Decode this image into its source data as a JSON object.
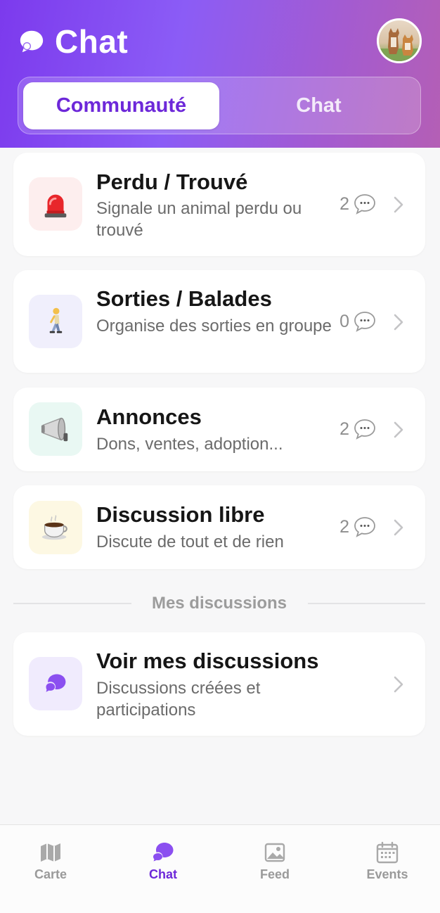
{
  "header": {
    "title": "Chat",
    "segments": [
      {
        "label": "Communauté",
        "active": true
      },
      {
        "label": "Chat",
        "active": false
      }
    ]
  },
  "categories": [
    {
      "title": "Perdu / Trouvé",
      "subtitle": "Signale un animal perdu ou trouvé",
      "count": "2",
      "icon": "siren-icon",
      "icon_bg": "#fdeeee"
    },
    {
      "title": "Sorties / Balades",
      "subtitle": "Organise des sorties en groupe",
      "count": "0",
      "icon": "walking-person-icon",
      "icon_bg": "#f0effc"
    },
    {
      "title": "Annonces",
      "subtitle": "Dons, ventes, adoption...",
      "count": "2",
      "icon": "megaphone-icon",
      "icon_bg": "#e9f8f3"
    },
    {
      "title": "Discussion libre",
      "subtitle": "Discute de tout et de rien",
      "count": "2",
      "icon": "coffee-cup-icon",
      "icon_bg": "#fdf8e3"
    }
  ],
  "section": {
    "label": "Mes discussions"
  },
  "my_discussions": {
    "title": "Voir mes discussions",
    "subtitle": "Discussions créées et participations",
    "icon": "chat-bubbles-icon",
    "icon_bg": "#f0ebfd"
  },
  "tabs": [
    {
      "label": "Carte",
      "icon": "map-icon",
      "active": false
    },
    {
      "label": "Chat",
      "icon": "chat-icon",
      "active": true
    },
    {
      "label": "Feed",
      "icon": "image-icon",
      "active": false
    },
    {
      "label": "Events",
      "icon": "calendar-icon",
      "active": false
    }
  ],
  "colors": {
    "accent": "#6d28d9",
    "header_start": "#7c3aed",
    "header_end": "#b45fb5"
  }
}
